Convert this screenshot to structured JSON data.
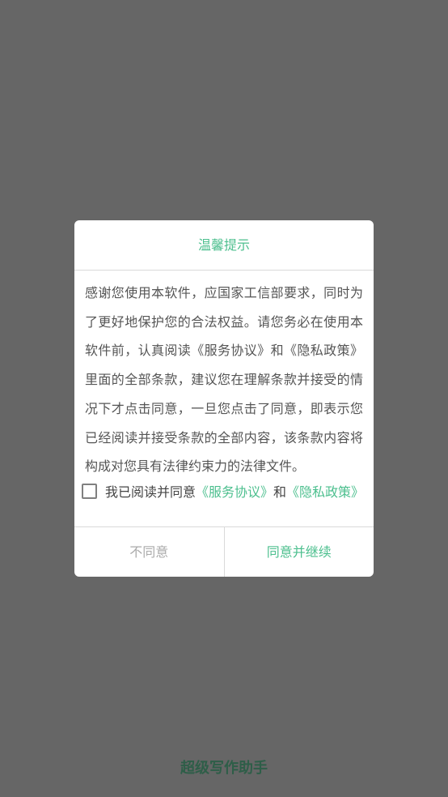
{
  "dialog": {
    "title": "温馨提示",
    "body": "感谢您使用本软件，应国家工信部要求，同时为了更好地保护您的合法权益。请您务必在使用本软件前，认真阅读《服务协议》和《隐私政策》里面的全部条款，建议您在理解条款并接受的情况下才点击同意，一旦您点击了同意，即表示您已经阅读并接受条款的全部内容，该条款内容将构成对您具有法律约束力的法律文件。",
    "agree_prefix": "我已阅读并同意",
    "service_link": "《服务协议》",
    "and_text": "和",
    "privacy_link": "《隐私政策》",
    "disagree_label": "不同意",
    "agree_label": "同意并继续"
  },
  "app": {
    "name": "超级写作助手"
  },
  "colors": {
    "accent": "#4CBF8E",
    "overlay": "#666666",
    "app_name": "#2E5E48"
  }
}
